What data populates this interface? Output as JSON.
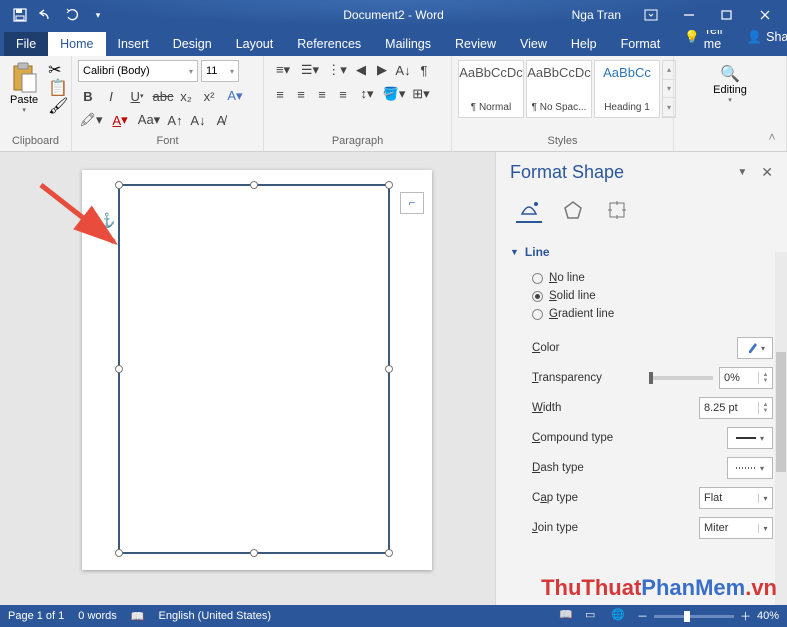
{
  "titlebar": {
    "doc_name": "Document2",
    "app_suffix": " - Word",
    "user_name": "Nga Tran"
  },
  "tabs": {
    "file": "File",
    "home": "Home",
    "insert": "Insert",
    "design": "Design",
    "layout": "Layout",
    "references": "References",
    "mailings": "Mailings",
    "review": "Review",
    "view": "View",
    "help": "Help",
    "format": "Format",
    "tellme": "Tell me",
    "share": "Share"
  },
  "ribbon": {
    "clipboard": {
      "paste": "Paste",
      "label": "Clipboard"
    },
    "font": {
      "name": "Calibri (Body)",
      "size": "11",
      "label": "Font"
    },
    "paragraph": {
      "label": "Paragraph"
    },
    "styles": {
      "label": "Styles",
      "items": [
        {
          "preview": "AaBbCcDc",
          "name": "¶ Normal"
        },
        {
          "preview": "AaBbCcDc",
          "name": "¶ No Spac..."
        },
        {
          "preview": "AaBbCc",
          "name": "Heading 1"
        }
      ]
    },
    "editing": {
      "label": "Editing"
    }
  },
  "panel": {
    "title": "Format Shape",
    "section_line": "Line",
    "radios": {
      "no_line": "No line",
      "solid_line": "Solid line",
      "gradient_line": "Gradient line"
    },
    "props": {
      "color": "Color",
      "transparency": "Transparency",
      "transparency_val": "0%",
      "width": "Width",
      "width_val": "8.25 pt",
      "compound": "Compound type",
      "dash": "Dash type",
      "cap": "Cap type",
      "cap_val": "Flat",
      "join": "Join type",
      "join_val": "Miter"
    }
  },
  "statusbar": {
    "page": "Page 1 of 1",
    "words": "0 words",
    "lang": "English (United States)",
    "zoom": "40%"
  },
  "watermark": {
    "a": "ThuThuat",
    "b": "PhanMem",
    "c": ".vn"
  }
}
